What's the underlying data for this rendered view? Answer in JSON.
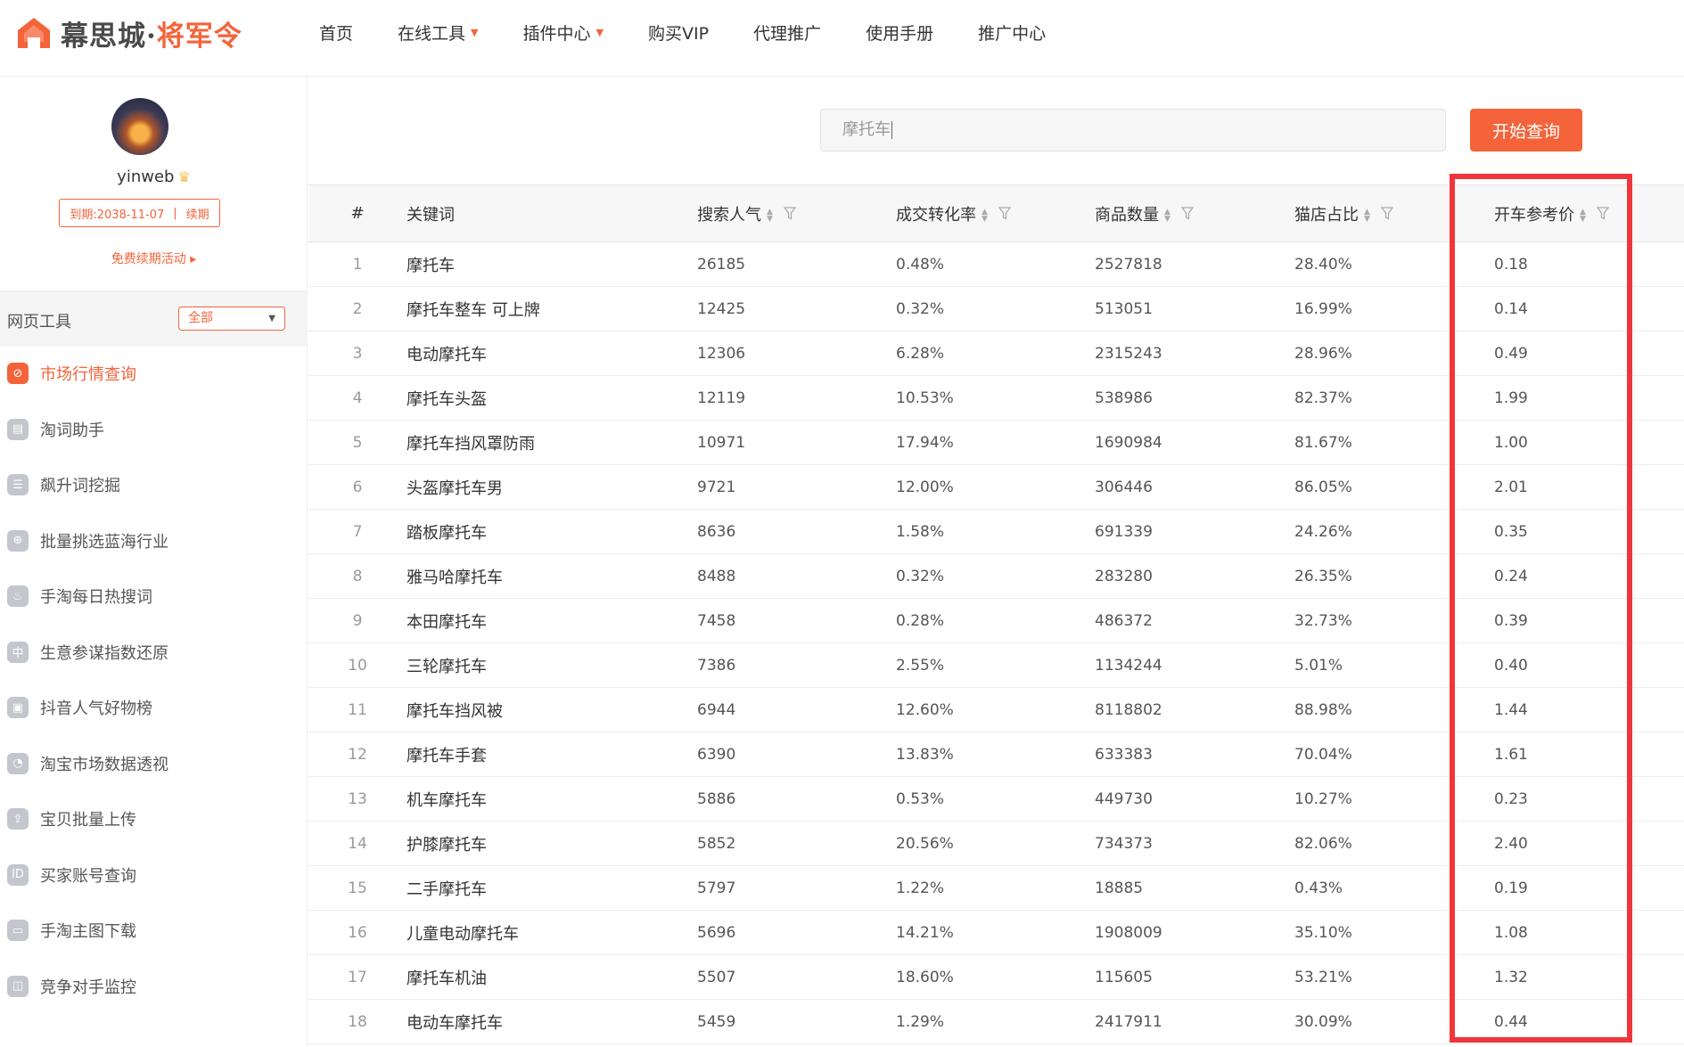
{
  "brand": {
    "name_a": "幕思城",
    "dot": "·",
    "name_b": "将军令",
    "color": "#f4633a"
  },
  "nav": [
    {
      "label": "首页",
      "caret": false
    },
    {
      "label": "在线工具",
      "caret": true
    },
    {
      "label": "插件中心",
      "caret": true
    },
    {
      "label": "购买VIP",
      "caret": false
    },
    {
      "label": "代理推广",
      "caret": false
    },
    {
      "label": "使用手册",
      "caret": false
    },
    {
      "label": "推广中心",
      "caret": false
    }
  ],
  "user": {
    "name": "yinweb",
    "expire_label": "到期:2038-11-07",
    "renew_label": "续期",
    "free_renew": "免费续期活动 ▸"
  },
  "tools": {
    "title": "网页工具",
    "filter_value": "全部",
    "items": [
      {
        "label": "市场行情查询",
        "icon": "compass-icon",
        "glyph": "⊘",
        "active": true
      },
      {
        "label": "淘词助手",
        "icon": "doc-icon",
        "glyph": "▤",
        "active": false
      },
      {
        "label": "飙升词挖掘",
        "icon": "list-icon",
        "glyph": "☰",
        "active": false
      },
      {
        "label": "批量挑选蓝海行业",
        "icon": "globe-icon",
        "glyph": "⊕",
        "active": false
      },
      {
        "label": "手淘每日热搜词",
        "icon": "fire-icon",
        "glyph": "♨",
        "active": false
      },
      {
        "label": "生意参谋指数还原",
        "icon": "zhong-icon",
        "glyph": "中",
        "active": false
      },
      {
        "label": "抖音人气好物榜",
        "icon": "image-icon",
        "glyph": "▣",
        "active": false
      },
      {
        "label": "淘宝市场数据透视",
        "icon": "gauge-icon",
        "glyph": "◔",
        "active": false
      },
      {
        "label": "宝贝批量上传",
        "icon": "upload-icon",
        "glyph": "⇪",
        "active": false
      },
      {
        "label": "买家账号查询",
        "icon": "id-icon",
        "glyph": "ID",
        "active": false
      },
      {
        "label": "手淘主图下载",
        "icon": "download-icon",
        "glyph": "▭",
        "active": false
      },
      {
        "label": "竞争对手监控",
        "icon": "bag-icon",
        "glyph": "◫",
        "active": false
      }
    ]
  },
  "search": {
    "value": "摩托车",
    "button_label": "开始查询"
  },
  "table": {
    "columns": [
      "#",
      "关键词",
      "搜索人气",
      "成交转化率",
      "商品数量",
      "猫店占比",
      "开车参考价"
    ],
    "rows": [
      [
        "1",
        "摩托车",
        "26185",
        "0.48%",
        "2527818",
        "28.40%",
        "0.18"
      ],
      [
        "2",
        "摩托车整车 可上牌",
        "12425",
        "0.32%",
        "513051",
        "16.99%",
        "0.14"
      ],
      [
        "3",
        "电动摩托车",
        "12306",
        "6.28%",
        "2315243",
        "28.96%",
        "0.49"
      ],
      [
        "4",
        "摩托车头盔",
        "12119",
        "10.53%",
        "538986",
        "82.37%",
        "1.99"
      ],
      [
        "5",
        "摩托车挡风罩防雨",
        "10971",
        "17.94%",
        "1690984",
        "81.67%",
        "1.00"
      ],
      [
        "6",
        "头盔摩托车男",
        "9721",
        "12.00%",
        "306446",
        "86.05%",
        "2.01"
      ],
      [
        "7",
        "踏板摩托车",
        "8636",
        "1.58%",
        "691339",
        "24.26%",
        "0.35"
      ],
      [
        "8",
        "雅马哈摩托车",
        "8488",
        "0.32%",
        "283280",
        "26.35%",
        "0.24"
      ],
      [
        "9",
        "本田摩托车",
        "7458",
        "0.28%",
        "486372",
        "32.73%",
        "0.39"
      ],
      [
        "10",
        "三轮摩托车",
        "7386",
        "2.55%",
        "1134244",
        "5.01%",
        "0.40"
      ],
      [
        "11",
        "摩托车挡风被",
        "6944",
        "12.60%",
        "8118802",
        "88.98%",
        "1.44"
      ],
      [
        "12",
        "摩托车手套",
        "6390",
        "13.83%",
        "633383",
        "70.04%",
        "1.61"
      ],
      [
        "13",
        "机车摩托车",
        "5886",
        "0.53%",
        "449730",
        "10.27%",
        "0.23"
      ],
      [
        "14",
        "护膝摩托车",
        "5852",
        "20.56%",
        "734373",
        "82.06%",
        "2.40"
      ],
      [
        "15",
        "二手摩托车",
        "5797",
        "1.22%",
        "18885",
        "0.43%",
        "0.19"
      ],
      [
        "16",
        "儿童电动摩托车",
        "5696",
        "14.21%",
        "1908009",
        "35.10%",
        "1.08"
      ],
      [
        "17",
        "摩托车机油",
        "5507",
        "18.60%",
        "115605",
        "53.21%",
        "1.32"
      ],
      [
        "18",
        "电动车摩托车",
        "5459",
        "1.29%",
        "2417911",
        "30.09%",
        "0.44"
      ]
    ]
  },
  "highlight": {
    "color": "#f0363a",
    "column": "开车参考价"
  }
}
